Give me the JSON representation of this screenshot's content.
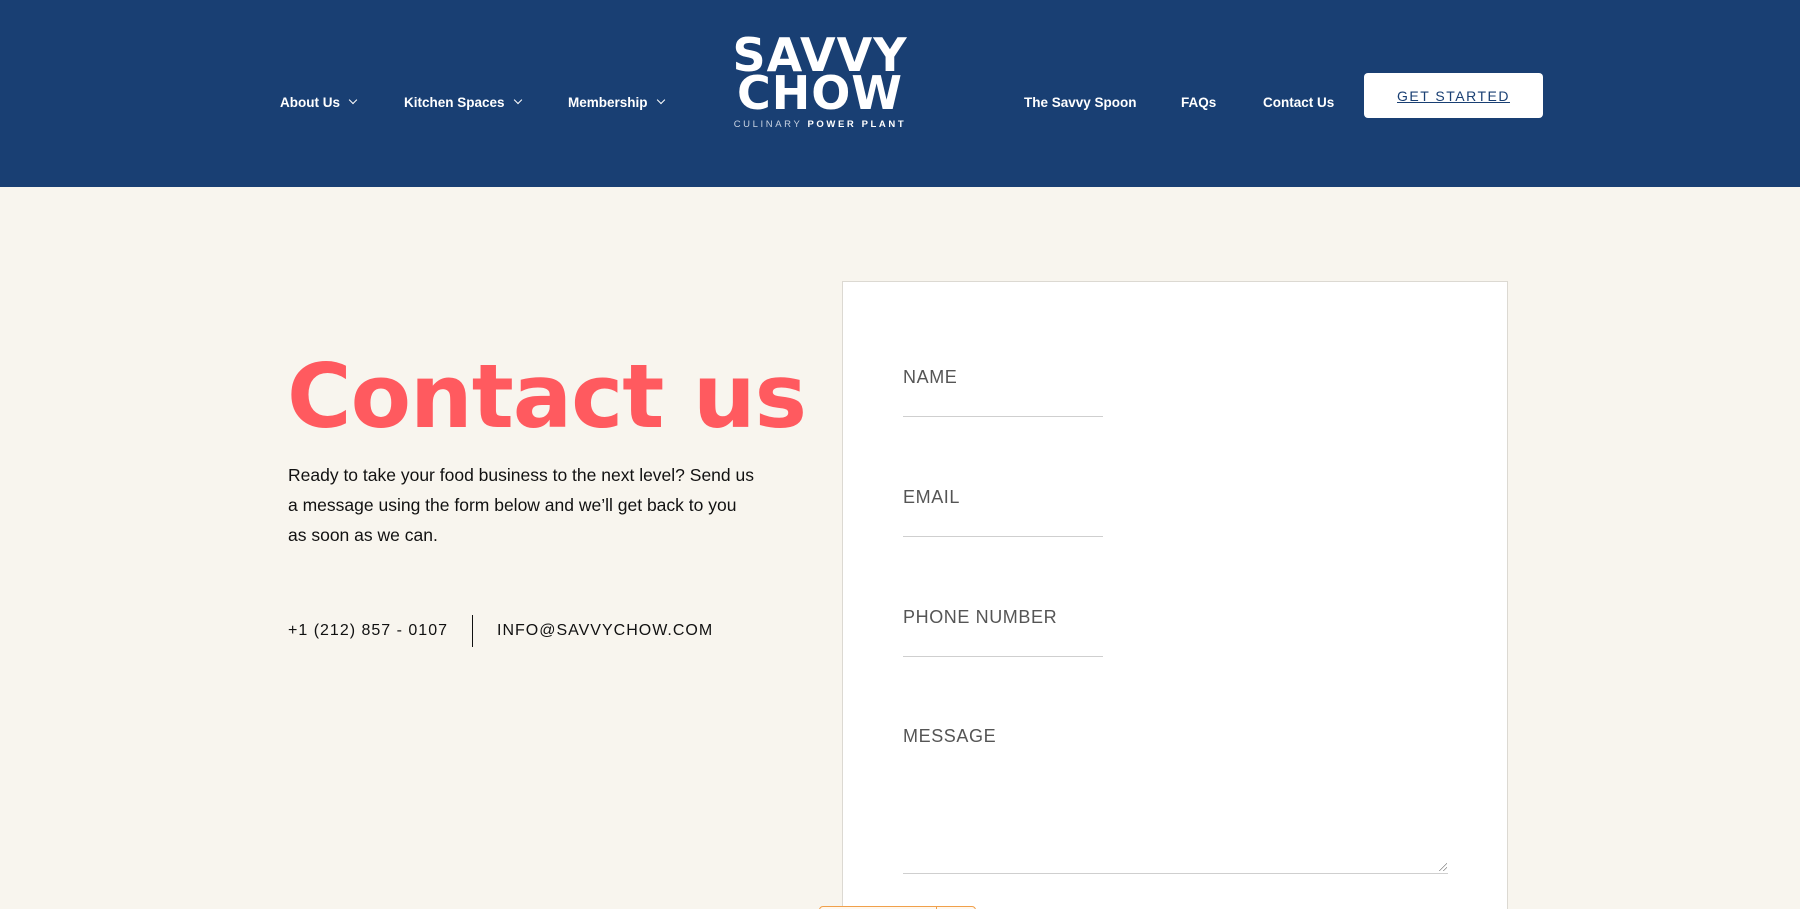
{
  "header": {
    "nav_left": [
      {
        "label": "About Us"
      },
      {
        "label": "Kitchen Spaces"
      },
      {
        "label": "Membership"
      }
    ],
    "logo": {
      "line1": "SAVVY",
      "line2": "CHOW",
      "tagline_a": "CULINARY",
      "tagline_b": "POWER PLANT"
    },
    "nav_right": [
      {
        "label": "The Savvy Spoon"
      },
      {
        "label": "FAQs"
      },
      {
        "label": "Contact Us"
      }
    ],
    "cta_label": "GET STARTED"
  },
  "hero": {
    "title": "Contact us",
    "lead": "Ready to take your food business to the next level? Send us a message using the form below and we’ll get back to you as soon as we can.",
    "phone": "+1 (212) 857 - 0107",
    "email": "INFO@SAVVYCHOW.COM"
  },
  "form": {
    "name_label": "NAME",
    "email_label": "EMAIL",
    "phone_label": "PHONE NUMBER",
    "message_label": "MESSAGE"
  },
  "colors": {
    "header_bg": "#193f73",
    "page_bg": "#f8f5ee",
    "accent": "#ff5a5f"
  }
}
